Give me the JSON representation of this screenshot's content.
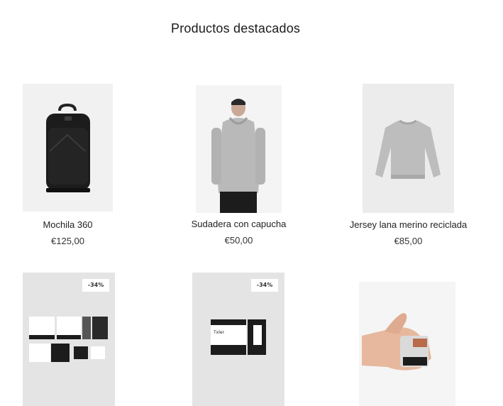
{
  "section": {
    "title": "Productos destacados"
  },
  "products": [
    {
      "name": "Mochila 360",
      "price": "€125,00",
      "image": "backpack-image"
    },
    {
      "name": "Sudadera con capucha",
      "price": "€50,00",
      "image": "hoodie-image"
    },
    {
      "name": "Jersey lana merino reciclada",
      "price": "€85,00",
      "image": "sweater-image"
    },
    {
      "badge": "-34%",
      "image": "tshirt-pack-image"
    },
    {
      "badge": "-34%",
      "image": "tshirt-folded-image"
    },
    {
      "image": "hand-wallet-image"
    }
  ],
  "colors": {
    "image_bg": "#e4e4e4",
    "product_black": "#1c1c1c",
    "product_grey": "#b9b9b9"
  }
}
